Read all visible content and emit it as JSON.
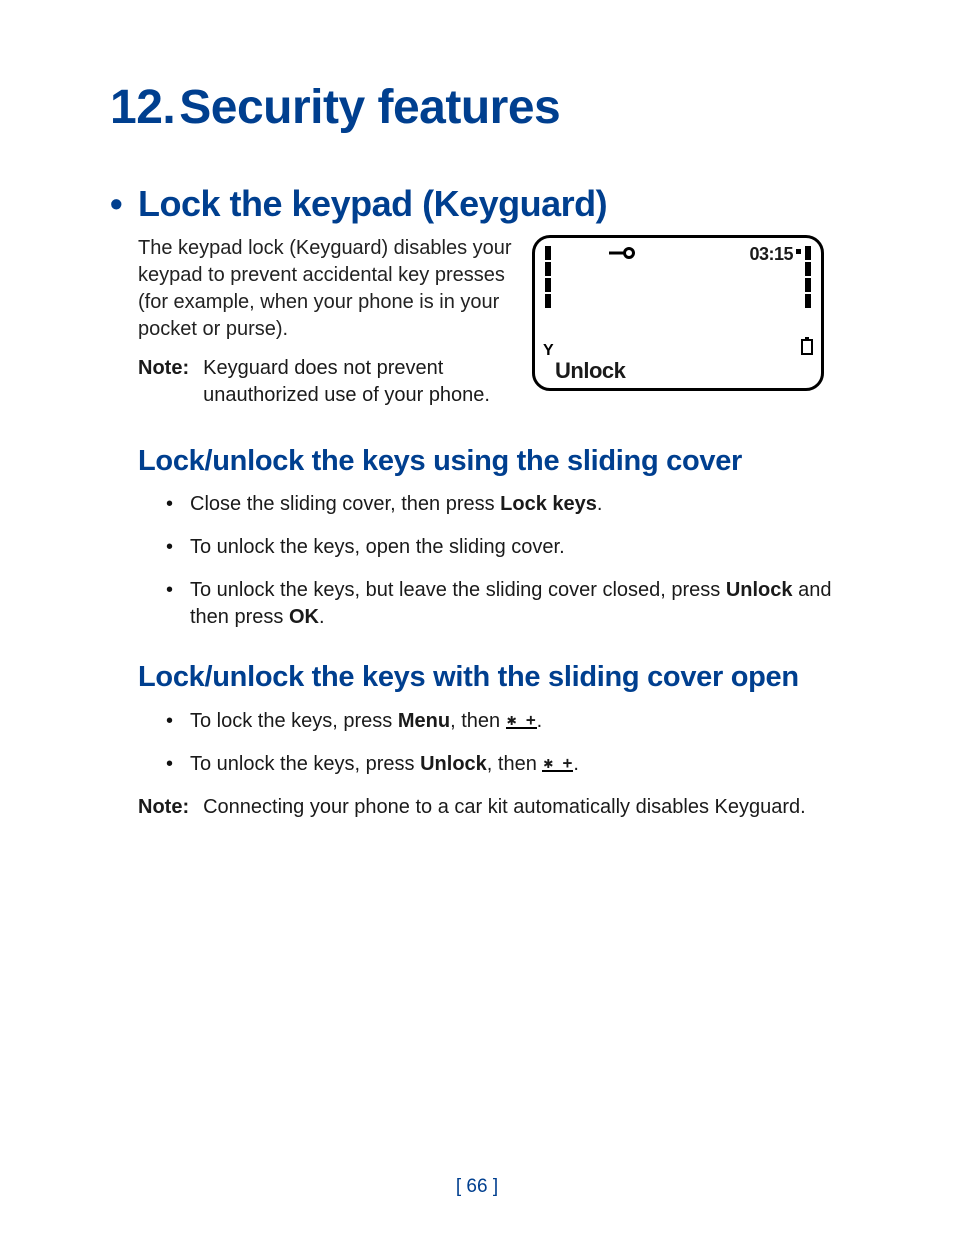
{
  "chapter": {
    "number": "12.",
    "title": "Security features"
  },
  "section1": {
    "bullet": "•",
    "title": "Lock the keypad (Keyguard)",
    "intro": "The keypad lock (Keyguard) disables your keypad to prevent accidental key presses (for example, when your phone is in your pocket or purse).",
    "note_label": "Note:",
    "note_text": "Keyguard does not prevent unauthorized use of your phone."
  },
  "phone_screen": {
    "time": "03:15",
    "softkey": "Unlock",
    "key_icon_alt": "key-icon"
  },
  "section2": {
    "title": "Lock/unlock the keys using the sliding cover",
    "items": [
      {
        "pre": "Close the sliding cover, then press ",
        "bold": "Lock keys",
        "post": "."
      },
      {
        "pre": "To unlock the keys, open the sliding cover.",
        "bold": "",
        "post": ""
      },
      {
        "pre": "To unlock the keys, but leave the sliding cover closed, press ",
        "bold": "Unlock",
        "mid": " and then press ",
        "bold2": "OK",
        "post": "."
      }
    ]
  },
  "section3": {
    "title": "Lock/unlock the keys with the sliding cover open",
    "items": [
      {
        "pre": "To lock the keys, press ",
        "bold": "Menu",
        "mid": ", then  ",
        "key": "✱ +",
        "post": "."
      },
      {
        "pre": "To unlock the keys, press ",
        "bold": "Unlock",
        "mid": ", then  ",
        "key": "✱ +",
        "post": "."
      }
    ],
    "note_label": "Note:",
    "note_text": "Connecting your phone to a car kit automatically disables Keyguard."
  },
  "page_number": "[ 66 ]"
}
